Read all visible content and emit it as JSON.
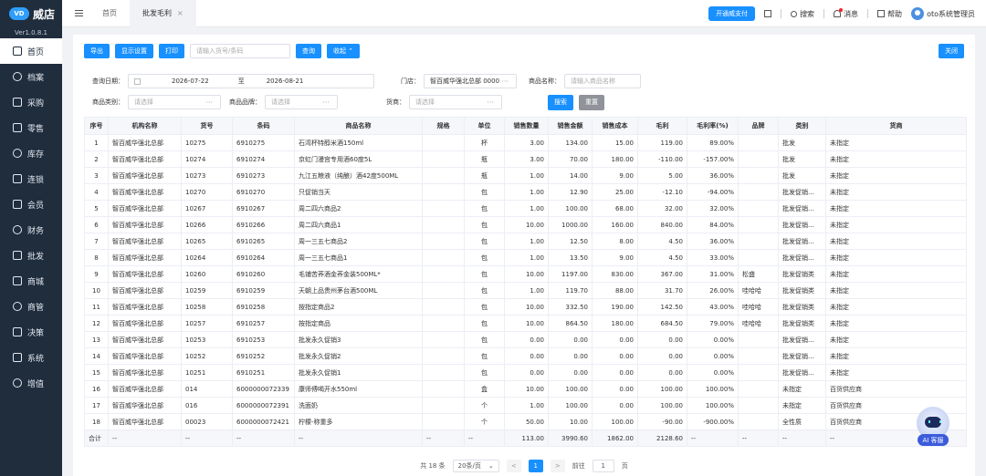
{
  "brand": {
    "logo_text": "VD",
    "name": "威店",
    "version": "Ver1.0.8.1"
  },
  "sidebar": {
    "items": [
      {
        "label": "首页",
        "icon": "home-icon",
        "active": true
      },
      {
        "label": "档案",
        "icon": "archive-icon"
      },
      {
        "label": "采购",
        "icon": "purchase-icon"
      },
      {
        "label": "零售",
        "icon": "retail-icon"
      },
      {
        "label": "库存",
        "icon": "stock-icon"
      },
      {
        "label": "连锁",
        "icon": "chain-icon"
      },
      {
        "label": "会员",
        "icon": "member-icon"
      },
      {
        "label": "财务",
        "icon": "finance-icon"
      },
      {
        "label": "批发",
        "icon": "wholesale-icon"
      },
      {
        "label": "商城",
        "icon": "mall-icon"
      },
      {
        "label": "商管",
        "icon": "merchant-icon"
      },
      {
        "label": "决策",
        "icon": "decision-icon"
      },
      {
        "label": "系统",
        "icon": "system-icon"
      },
      {
        "label": "增值",
        "icon": "addon-icon"
      }
    ]
  },
  "tabs": {
    "home": "首页",
    "active": "批发毛利",
    "close": "×"
  },
  "header": {
    "pay_button": "开通威支付",
    "search": "搜索",
    "messages": "消息",
    "help": "帮助",
    "user": "oto系统管理员"
  },
  "toolbar": {
    "export": "导出",
    "display_settings": "显示设置",
    "print": "打印",
    "search_placeholder": "请输入货号/条码",
    "query": "查询",
    "collapse": "收起 ⌃",
    "close": "关闭"
  },
  "filters": {
    "date_label": "查询日期：",
    "date_start": "2026-07-22",
    "date_to": "至",
    "date_end": "2026-08-21",
    "store_label": "门店：",
    "store_value": "智百威华强北总部 0000",
    "product_name_label": "商品名称：",
    "product_name_placeholder": "请输入商品名称",
    "category_label": "商品类别：",
    "category_placeholder": "请选择",
    "brand_label": "商品品牌：",
    "brand_placeholder": "请选择",
    "supplier_label": "货商：",
    "supplier_placeholder": "请选择",
    "search": "搜索",
    "reset": "重置",
    "more": "···"
  },
  "table": {
    "headers": [
      "序号",
      "机构名称",
      "货号",
      "条码",
      "商品名称",
      "规格",
      "单位",
      "销售数量",
      "销售金额",
      "销售成本",
      "毛利",
      "毛利率(%)",
      "品牌",
      "类别",
      "货商"
    ],
    "rows": [
      [
        "1",
        "智百威华强北总部",
        "10275",
        "6910275",
        "石湾杯特醇米酒150ml",
        "",
        "杯",
        "3.00",
        "134.00",
        "15.00",
        "119.00",
        "89.00%",
        "",
        "批发",
        "未指定"
      ],
      [
        "2",
        "智百威华强北总部",
        "10274",
        "6910274",
        "京虹门漫宫专用酒60度5L",
        "",
        "瓶",
        "3.00",
        "70.00",
        "180.00",
        "-110.00",
        "-157.00%",
        "",
        "批发",
        "未指定"
      ],
      [
        "3",
        "智百威华强北总部",
        "10273",
        "6910273",
        "九江五粮液（纯酿）酒42度500ML",
        "",
        "瓶",
        "1.00",
        "14.00",
        "9.00",
        "5.00",
        "36.00%",
        "",
        "批发",
        "未指定"
      ],
      [
        "4",
        "智百威华强北总部",
        "10270",
        "6910270",
        "只促销当天",
        "",
        "包",
        "1.00",
        "12.90",
        "25.00",
        "-12.10",
        "-94.00%",
        "",
        "批发促销...",
        "未指定"
      ],
      [
        "5",
        "智百威华强北总部",
        "10267",
        "6910267",
        "周二四六商品2",
        "",
        "包",
        "1.00",
        "100.00",
        "68.00",
        "32.00",
        "32.00%",
        "",
        "批发促销...",
        "未指定"
      ],
      [
        "6",
        "智百威华强北总部",
        "10266",
        "6910266",
        "周二四六商品1",
        "",
        "包",
        "10.00",
        "1000.00",
        "160.00",
        "840.00",
        "84.00%",
        "",
        "批发促销...",
        "未指定"
      ],
      [
        "7",
        "智百威华强北总部",
        "10265",
        "6910265",
        "周一三五七商品2",
        "",
        "包",
        "1.00",
        "12.50",
        "8.00",
        "4.50",
        "36.00%",
        "",
        "批发促销...",
        "未指定"
      ],
      [
        "8",
        "智百威华强北总部",
        "10264",
        "6910264",
        "周一三五七商品1",
        "",
        "包",
        "1.00",
        "13.50",
        "9.00",
        "4.50",
        "33.00%",
        "",
        "批发促销...",
        "未指定"
      ],
      [
        "9",
        "智百威华强北总部",
        "10260",
        "6910260",
        "毛铺苦荞酒金荞金装500ML*",
        "",
        "包",
        "10.00",
        "1197.00",
        "830.00",
        "367.00",
        "31.00%",
        "松盛",
        "批发促销类",
        "未指定"
      ],
      [
        "10",
        "智百威华强北总部",
        "10259",
        "6910259",
        "天朝上品贵州茅台酒500ML",
        "",
        "包",
        "1.00",
        "119.70",
        "88.00",
        "31.70",
        "26.00%",
        "哇哈哈",
        "批发促销类",
        "未指定"
      ],
      [
        "11",
        "智百威华强北总部",
        "10258",
        "6910258",
        "按指定商品2",
        "",
        "包",
        "10.00",
        "332.50",
        "190.00",
        "142.50",
        "43.00%",
        "哇哈哈",
        "批发促销类",
        "未指定"
      ],
      [
        "12",
        "智百威华强北总部",
        "10257",
        "6910257",
        "按指定商品",
        "",
        "包",
        "10.00",
        "864.50",
        "180.00",
        "684.50",
        "79.00%",
        "哇哈哈",
        "批发促销类",
        "未指定"
      ],
      [
        "13",
        "智百威华强北总部",
        "10253",
        "6910253",
        "批发永久促销3",
        "",
        "包",
        "0.00",
        "0.00",
        "0.00",
        "0.00",
        "0.00%",
        "",
        "批发促销...",
        "未指定"
      ],
      [
        "14",
        "智百威华强北总部",
        "10252",
        "6910252",
        "批发永久促销2",
        "",
        "包",
        "0.00",
        "0.00",
        "0.00",
        "0.00",
        "0.00%",
        "",
        "批发促销...",
        "未指定"
      ],
      [
        "15",
        "智百威华强北总部",
        "10251",
        "6910251",
        "批发永久促销1",
        "",
        "包",
        "0.00",
        "0.00",
        "0.00",
        "0.00",
        "0.00%",
        "",
        "批发促销...",
        "未指定"
      ],
      [
        "16",
        "智百威华强北总部",
        "014",
        "6000000072339",
        "康师傅喝开水550ml",
        "",
        "盒",
        "10.00",
        "100.00",
        "0.00",
        "100.00",
        "100.00%",
        "",
        "未指定",
        "百货供应商"
      ],
      [
        "17",
        "智百威华强北总部",
        "016",
        "6000000072391",
        "洗面奶",
        "",
        "个",
        "1.00",
        "100.00",
        "0.00",
        "100.00",
        "100.00%",
        "",
        "未指定",
        "百货供应商"
      ],
      [
        "18",
        "智百威华强北总部",
        "00023",
        "6000000072421",
        "柠檬-称重多",
        "",
        "个",
        "50.00",
        "10.00",
        "100.00",
        "-90.00",
        "-900.00%",
        "",
        "全性质",
        "百货供应商"
      ]
    ],
    "summary": [
      "合计",
      "--",
      "--",
      "--",
      "--",
      "--",
      "--",
      "113.00",
      "3990.60",
      "1862.00",
      "2128.60",
      "--",
      "--",
      "--",
      "--"
    ]
  },
  "pagination": {
    "total": "共 18 条",
    "page_size": "20条/页",
    "prev": "<",
    "current": "1",
    "next": ">",
    "goto": "前往",
    "goto_value": "1",
    "page_unit": "页"
  },
  "service": {
    "label": "AI 客服"
  }
}
